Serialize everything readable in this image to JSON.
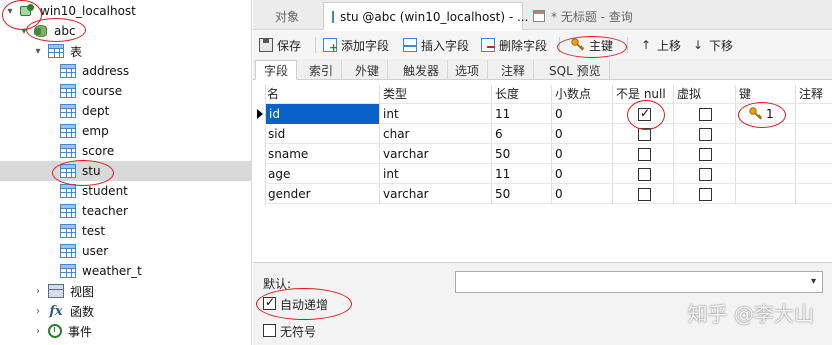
{
  "tree": {
    "connection": "win10_localhost",
    "database": "abc",
    "tables_group": "表",
    "tables": [
      "address",
      "course",
      "dept",
      "emp",
      "score",
      "stu",
      "student",
      "teacher",
      "test",
      "user",
      "weather_t"
    ],
    "selected_table": "stu",
    "views_group": "视图",
    "functions_group": "函数",
    "events_group": "事件"
  },
  "tabs": [
    {
      "label": "对象"
    },
    {
      "label": "stu @abc (win10_localhost) - ..."
    },
    {
      "label": "* 无标题 - 查询"
    }
  ],
  "toolbar": {
    "save": "保存",
    "add_field": "添加字段",
    "insert_field": "插入字段",
    "delete_field": "删除字段",
    "primary_key": "主键",
    "move_up": "上移",
    "move_down": "下移"
  },
  "subtabs": [
    "字段",
    "索引",
    "外键",
    "触发器",
    "选项",
    "注释",
    "SQL 预览"
  ],
  "grid": {
    "headers": [
      "名",
      "类型",
      "长度",
      "小数点",
      "不是 null",
      "虚拟",
      "键",
      "注释"
    ],
    "rows": [
      {
        "name": "id",
        "type": "int",
        "length": "11",
        "decimals": "0",
        "not_null": true,
        "virtual": false,
        "key": "1"
      },
      {
        "name": "sid",
        "type": "char",
        "length": "6",
        "decimals": "0",
        "not_null": false,
        "virtual": false,
        "key": ""
      },
      {
        "name": "sname",
        "type": "varchar",
        "length": "50",
        "decimals": "0",
        "not_null": false,
        "virtual": false,
        "key": ""
      },
      {
        "name": "age",
        "type": "int",
        "length": "11",
        "decimals": "0",
        "not_null": false,
        "virtual": false,
        "key": ""
      },
      {
        "name": "gender",
        "type": "varchar",
        "length": "50",
        "decimals": "0",
        "not_null": false,
        "virtual": false,
        "key": ""
      }
    ]
  },
  "bottom": {
    "default_label": "默认:",
    "auto_increment_label": "自动递增",
    "auto_increment": true,
    "unsigned_label": "无符号",
    "unsigned": false
  },
  "watermark": "知乎 @李大山"
}
